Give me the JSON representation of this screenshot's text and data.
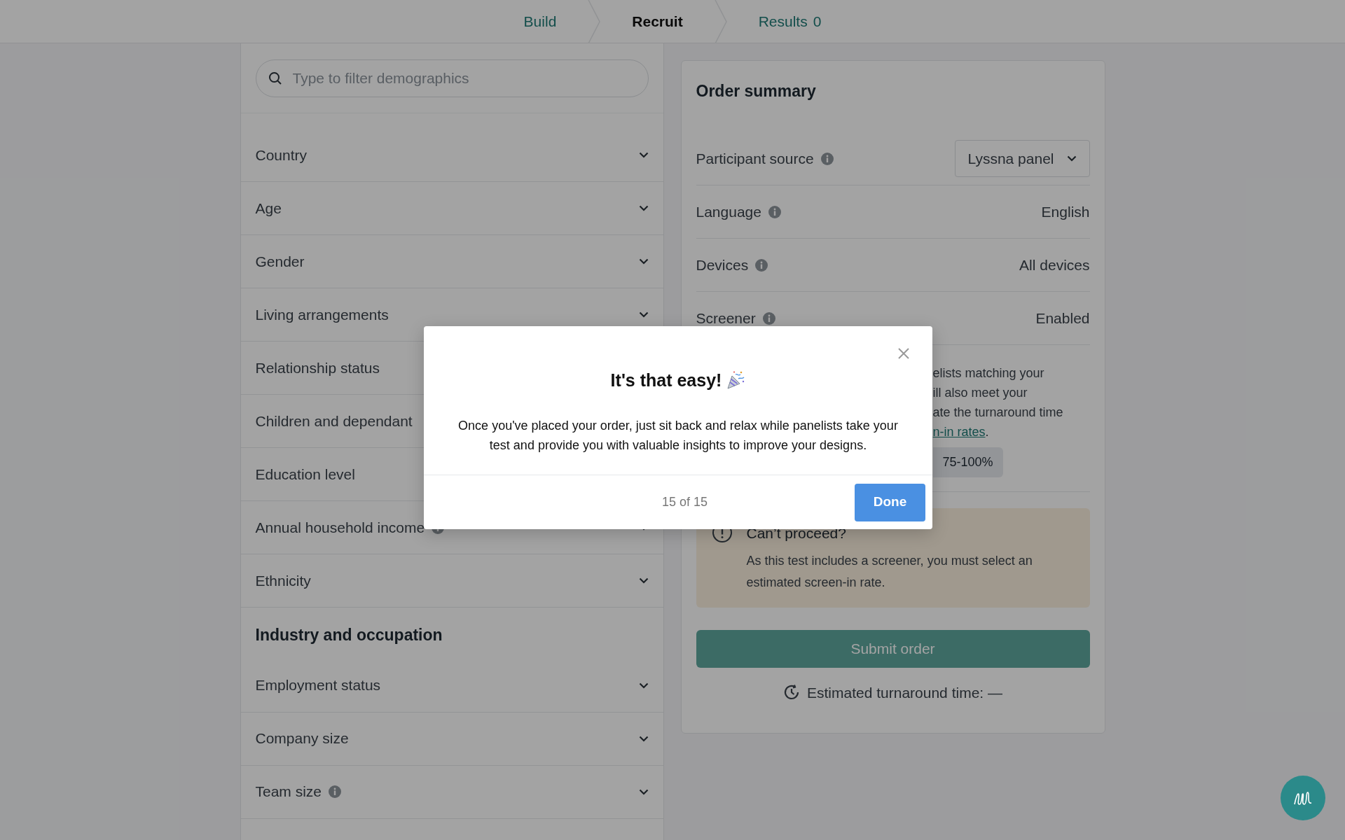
{
  "steps": [
    {
      "label": "Build",
      "selected": false
    },
    {
      "label": "Recruit",
      "selected": true
    },
    {
      "label": "Results",
      "count": "0",
      "selected": false
    }
  ],
  "filter": {
    "placeholder": "Type to filter demographics"
  },
  "demographics": [
    {
      "label": "Country",
      "info": false,
      "chevron": true
    },
    {
      "label": "Age",
      "info": false,
      "chevron": true
    },
    {
      "label": "Gender",
      "info": false,
      "chevron": true
    },
    {
      "label": "Living arrangements",
      "info": false,
      "chevron": true
    },
    {
      "label": "Relationship status",
      "info": false
    },
    {
      "label": "Children and dependant",
      "info": false
    },
    {
      "label": "Education level",
      "info": false
    },
    {
      "label": "Annual household income",
      "info": true,
      "chevron": true
    },
    {
      "label": "Ethnicity",
      "info": false,
      "chevron": true
    }
  ],
  "industry": {
    "heading": "Industry and occupation",
    "items": [
      {
        "label": "Employment status",
        "info": false,
        "chevron": true
      },
      {
        "label": "Company size",
        "info": false,
        "chevron": true
      },
      {
        "label": "Team size",
        "info": true,
        "chevron": true
      }
    ]
  },
  "order_summary": {
    "title": "Order summary",
    "rows": [
      {
        "kind": "select",
        "label": "Participant source",
        "info": true,
        "value": "Lyssna panel"
      },
      {
        "kind": "text",
        "label": "Language",
        "info": true,
        "value": "English"
      },
      {
        "kind": "text",
        "label": "Devices",
        "info": true,
        "value": "All devices"
      },
      {
        "kind": "text",
        "label": "Screener",
        "info": true,
        "value": "Enabled"
      }
    ],
    "description_lines": [
      "elists matching your",
      "ill also meet your",
      "ate the turnaround time"
    ],
    "link": "n-in rates",
    "link_after": ".",
    "rate_option": "75-100%",
    "warning": {
      "title": "Can’t proceed?",
      "body": "As this test includes a screener, you must select an estimated screen-in rate."
    },
    "submit": {
      "label": "Submit order",
      "disabled": true
    },
    "turnaround": "Estimated turnaround time: —"
  },
  "modal": {
    "title": "It's that easy!",
    "body": "Once you've placed your order, just sit back and relax while panelists take your test and provide you with valuable insights to improve your designs.",
    "progress": "15 of 15",
    "button": "Done"
  }
}
